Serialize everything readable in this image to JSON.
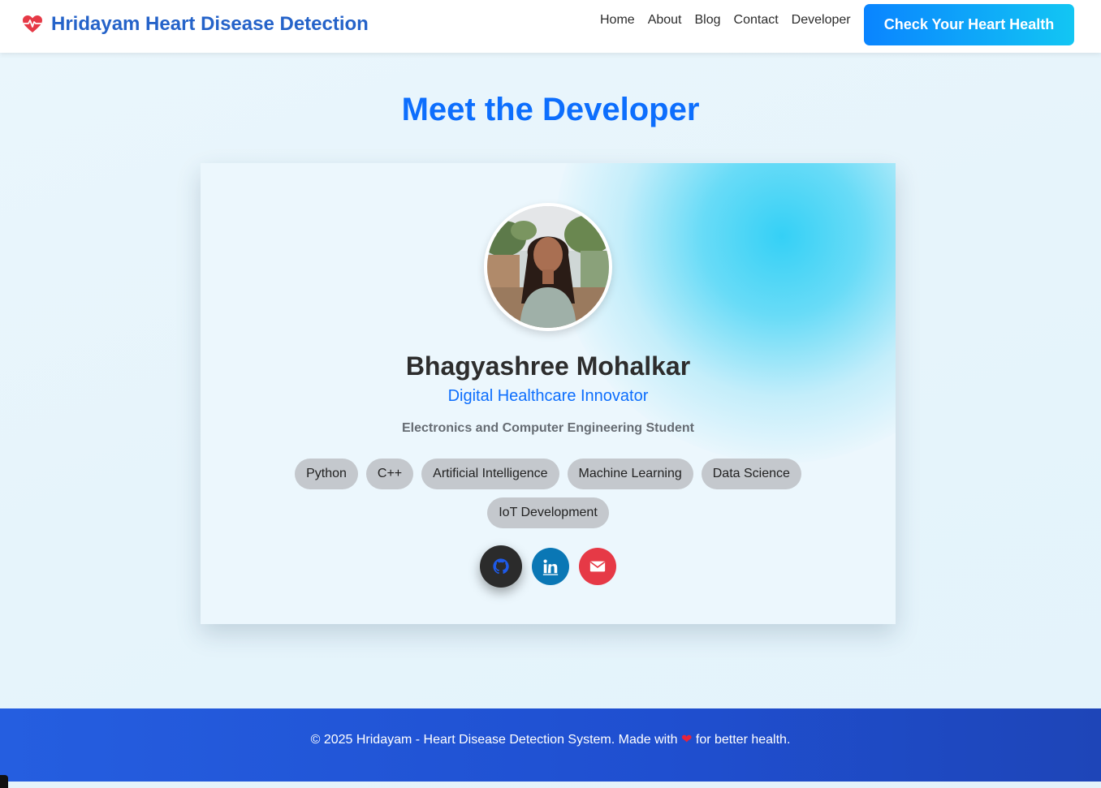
{
  "header": {
    "brand": "Hridayam Heart Disease Detection",
    "nav": [
      "Home",
      "About",
      "Blog",
      "Contact",
      "Developer"
    ],
    "cta": "Check Your Heart Health"
  },
  "page": {
    "title": "Meet the Developer"
  },
  "developer": {
    "name": "Bhagyashree Mohalkar",
    "role": "Digital Healthcare Innovator",
    "education": "Electronics and Computer Engineering Student",
    "skills": [
      "Python",
      "C++",
      "Artificial Intelligence",
      "Machine Learning",
      "Data Science",
      "IoT Development"
    ],
    "socials": [
      "github-icon",
      "linkedin-icon",
      "email-icon"
    ]
  },
  "footer": {
    "text_before": "© 2025 Hridayam - Heart Disease Detection System. Made with",
    "heart": "❤",
    "text_after": "for better health."
  },
  "colors": {
    "brand": "#2563c9",
    "accent": "#0d6efd",
    "footer": "#255ee0",
    "github": "#2b2b2b",
    "linkedin": "#0a77b5",
    "email": "#e63946"
  }
}
